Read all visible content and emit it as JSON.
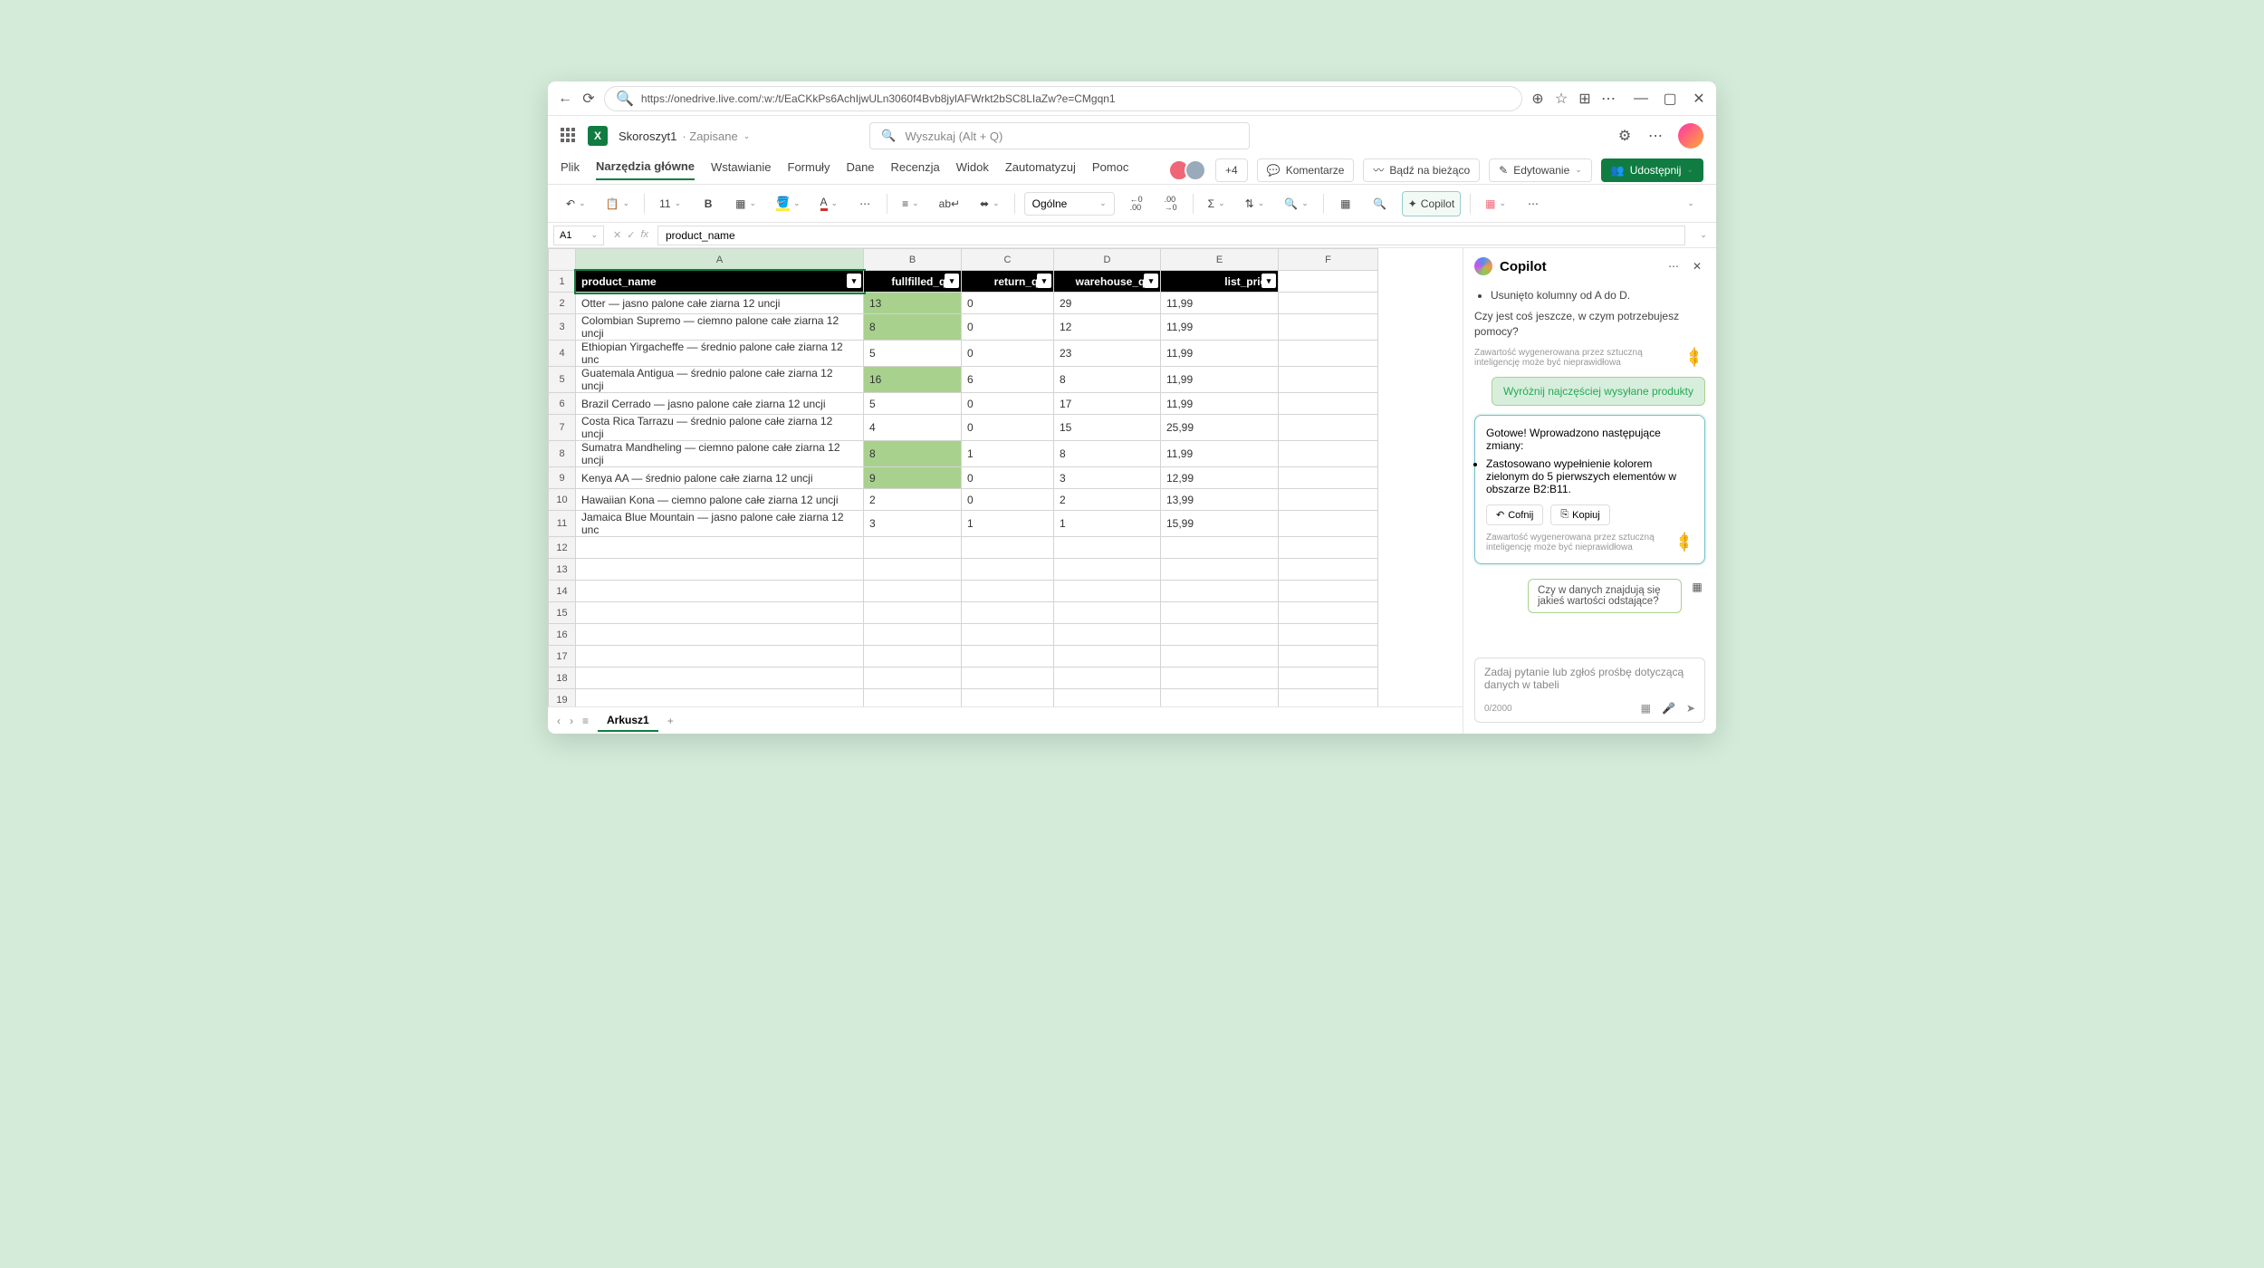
{
  "browser": {
    "url": "https://onedrive.live.com/:w:/t/EaCKkPs6AchIjwULn3060f4Bvb8jylAFWrkt2bSC8LIaZw?e=CMgqn1"
  },
  "titlebar": {
    "doc_name": "Skoroszyt1",
    "saved": "Zapisane",
    "search_placeholder": "Wyszukaj (Alt + Q)"
  },
  "ribbon": {
    "tabs": [
      "Plik",
      "Narzędzia główne",
      "Wstawianie",
      "Formuły",
      "Dane",
      "Recenzja",
      "Widok",
      "Zautomatyzuj",
      "Pomoc"
    ],
    "active_tab": 1,
    "presence_extra": "+4",
    "comments": "Komentarze",
    "catchup": "Bądź na bieżąco",
    "editing": "Edytowanie",
    "share": "Udostępnij"
  },
  "toolbar": {
    "font_size": "11",
    "number_format": "Ogólne",
    "copilot": "Copilot"
  },
  "formula_bar": {
    "name_box": "A1",
    "formula": "product_name"
  },
  "sheet": {
    "columns": [
      "A",
      "B",
      "C",
      "D",
      "E",
      "F"
    ],
    "headers": [
      "product_name",
      "fullfilled_qty",
      "return_qty",
      "warehouse_qty",
      "list_price"
    ],
    "rows": [
      {
        "n": 2,
        "a": "Otter — jasno palone całe ziarna 12 uncji",
        "b": "13",
        "c": "0",
        "d": "29",
        "e": "11,99",
        "hl": true
      },
      {
        "n": 3,
        "a": "Colombian Supremo — ciemno palone całe ziarna 12 uncji",
        "b": "8",
        "c": "0",
        "d": "12",
        "e": "11,99",
        "hl": true
      },
      {
        "n": 4,
        "a": "Ethiopian Yirgacheffe — średnio palone całe ziarna 12 unc",
        "b": "5",
        "c": "0",
        "d": "23",
        "e": "11,99",
        "hl": false
      },
      {
        "n": 5,
        "a": "Guatemala Antigua — średnio palone całe ziarna 12 uncji",
        "b": "16",
        "c": "6",
        "d": "8",
        "e": "11,99",
        "hl": true
      },
      {
        "n": 6,
        "a": "Brazil Cerrado — jasno palone całe ziarna 12 uncji",
        "b": "5",
        "c": "0",
        "d": "17",
        "e": "11,99",
        "hl": false
      },
      {
        "n": 7,
        "a": "Costa Rica Tarrazu — średnio palone całe ziarna 12 uncji",
        "b": "4",
        "c": "0",
        "d": "15",
        "e": "25,99",
        "hl": false
      },
      {
        "n": 8,
        "a": "Sumatra Mandheling — ciemno palone całe ziarna 12 uncji",
        "b": "8",
        "c": "1",
        "d": "8",
        "e": "11,99",
        "hl": true
      },
      {
        "n": 9,
        "a": "Kenya AA — średnio palone całe ziarna 12 uncji",
        "b": "9",
        "c": "0",
        "d": "3",
        "e": "12,99",
        "hl": true
      },
      {
        "n": 10,
        "a": "Hawaiian Kona — ciemno palone całe ziarna 12 uncji",
        "b": "2",
        "c": "0",
        "d": "2",
        "e": "13,99",
        "hl": false
      },
      {
        "n": 11,
        "a": "Jamaica Blue Mountain — jasno palone całe ziarna 12 unc",
        "b": "3",
        "c": "1",
        "d": "1",
        "e": "15,99",
        "hl": false
      }
    ],
    "empty_rows": [
      12,
      13,
      14,
      15,
      16,
      17,
      18,
      19
    ],
    "tab_name": "Arkusz1"
  },
  "copilot": {
    "title": "Copilot",
    "m1_bullet": "Usunięto kolumny od A do D.",
    "m1_question": "Czy jest coś jeszcze, w czym potrzebujesz pomocy?",
    "disclaimer": "Zawartość wygenerowana przez sztuczną inteligencję może być nieprawidłowa",
    "user_chip": "Wyróżnij najczęściej wysyłane produkty",
    "card_intro": "Gotowe! Wprowadzono następujące zmiany:",
    "card_bullet": "Zastosowano wypełnienie kolorem zielonym do 5 pierwszych elementów w obszarze B2:B11.",
    "undo": "Cofnij",
    "copy": "Kopiuj",
    "suggestion": "Czy w danych znajdują się jakieś wartości odstające?",
    "input_placeholder": "Zadaj pytanie lub zgłoś prośbę dotyczącą danych w tabeli",
    "count": "0/2000"
  }
}
